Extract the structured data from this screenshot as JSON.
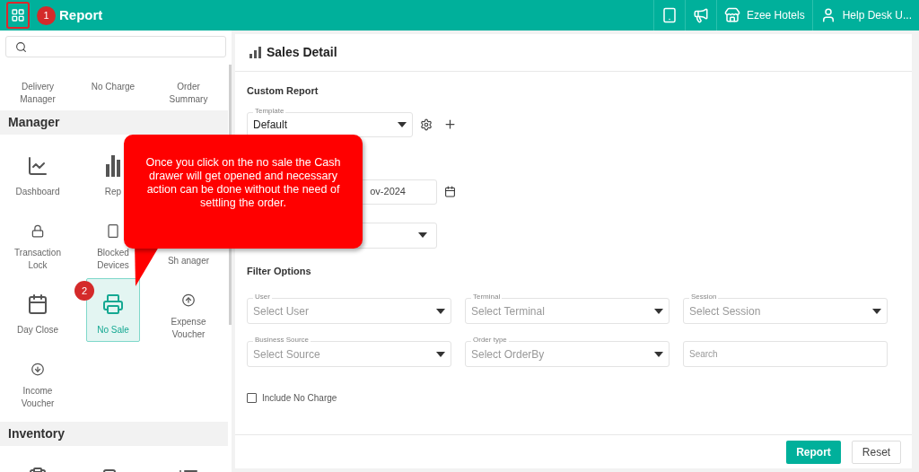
{
  "header": {
    "title": "Report",
    "actions": [
      {
        "kind": "device"
      },
      {
        "kind": "announce"
      },
      {
        "kind": "store",
        "label": "Ezee Hotels"
      },
      {
        "kind": "user",
        "label": "Help Desk U..."
      }
    ]
  },
  "sidebar": {
    "top_items": [
      {
        "label": "Delivery Manager"
      },
      {
        "label": "No Charge"
      },
      {
        "label": "Order Summary"
      }
    ],
    "sections": [
      {
        "title": "Manager",
        "items": [
          {
            "kind": "dashboard",
            "label": "Dashboard",
            "selected": false
          },
          {
            "kind": "reports",
            "label": "Rep",
            "selected": false
          },
          {
            "kind": "none"
          },
          {
            "kind": "lock",
            "label": "Transaction Lock",
            "selected": false
          },
          {
            "kind": "devices",
            "label": "Blocked Devices",
            "selected": false
          },
          {
            "kind": "shift",
            "label": "Sh anager",
            "selected": false
          },
          {
            "kind": "day-close",
            "label": "Day Close",
            "selected": false
          },
          {
            "kind": "no-sale",
            "label": "No Sale",
            "selected": true
          },
          {
            "kind": "expense",
            "label": "Expense Voucher",
            "selected": false
          },
          {
            "kind": "income",
            "label": "Income Voucher",
            "selected": false
          }
        ]
      },
      {
        "title": "Inventory",
        "items": [
          {
            "kind": "clipboard",
            "selected": false
          },
          {
            "kind": "transfer",
            "selected": false
          },
          {
            "kind": "list",
            "selected": false
          }
        ]
      }
    ]
  },
  "panel": {
    "title": "Sales Detail",
    "custom_report": {
      "heading": "Custom Report",
      "template": {
        "label": "Template",
        "value": "Default"
      },
      "date": {
        "value": "ov-2024"
      }
    },
    "filter": {
      "heading": "Filter Options",
      "fields": [
        {
          "kind": "select",
          "label": "User",
          "placeholder": "Select User"
        },
        {
          "kind": "select",
          "label": "Terminal",
          "placeholder": "Select Terminal"
        },
        {
          "kind": "select",
          "label": "Session",
          "placeholder": "Select Session"
        },
        {
          "kind": "select",
          "label": "Business Source",
          "placeholder": "Select Source"
        },
        {
          "kind": "select",
          "label": "Order type",
          "placeholder": "Select OrderBy"
        },
        {
          "kind": "text",
          "placeholder": "Search"
        }
      ],
      "include_no_charge": {
        "label": "Include No Charge",
        "checked": false
      }
    },
    "buttons": [
      {
        "kind": "primary",
        "label": "Report"
      },
      {
        "kind": "secondary",
        "label": "Reset"
      }
    ]
  },
  "annotations": {
    "badges": [
      "1",
      "2"
    ],
    "callout": "Once you click on the no sale the Cash drawer will get opened and necessary action can be done without the need of settling the order."
  }
}
